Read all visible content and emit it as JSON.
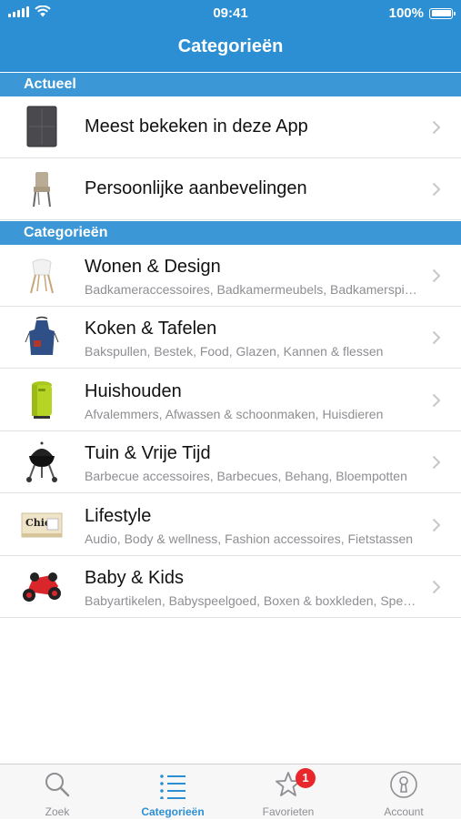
{
  "status_bar": {
    "time": "09:41",
    "battery": "100%"
  },
  "nav": {
    "title": "Categorieën"
  },
  "sections": {
    "current": "Actueel",
    "categories": "Categorieën"
  },
  "current_items": [
    {
      "title": "Meest bekeken in deze App",
      "icon": "tablet-icon"
    },
    {
      "title": "Persoonlijke aanbevelingen",
      "icon": "chair-icon"
    }
  ],
  "category_items": [
    {
      "title": "Wonen & Design",
      "subtitle": "Badkameraccessoires, Badkamermeubels, Badkamerspiegels",
      "icon": "chair-icon"
    },
    {
      "title": "Koken & Tafelen",
      "subtitle": "Bakspullen, Bestek, Food, Glazen, Kannen & flessen",
      "icon": "apron-icon"
    },
    {
      "title": "Huishouden",
      "subtitle": "Afvalemmers, Afwassen & schoonmaken, Huisdieren",
      "icon": "trash-bin-icon"
    },
    {
      "title": "Tuin & Vrije Tijd",
      "subtitle": "Barbecue accessoires, Barbecues, Behang, Bloempotten",
      "icon": "barbecue-icon"
    },
    {
      "title": "Lifestyle",
      "subtitle": "Audio, Body & wellness, Fashion accessoires, Fietstassen",
      "icon": "book-icon"
    },
    {
      "title": "Baby & Kids",
      "subtitle": "Babyartikelen, Babyspeelgoed, Boxen & boxkleden, Speelgoed",
      "icon": "toy-car-icon"
    }
  ],
  "tabs": [
    {
      "label": "Zoek",
      "icon": "search-icon",
      "active": false
    },
    {
      "label": "Categorieën",
      "icon": "list-icon",
      "active": true
    },
    {
      "label": "Favorieten",
      "icon": "star-icon",
      "active": false,
      "badge": "1"
    },
    {
      "label": "Account",
      "icon": "lock-icon",
      "active": false
    }
  ],
  "colors": {
    "accent": "#2d8fd3",
    "section": "#3c97d6",
    "badge": "#e8262c"
  }
}
